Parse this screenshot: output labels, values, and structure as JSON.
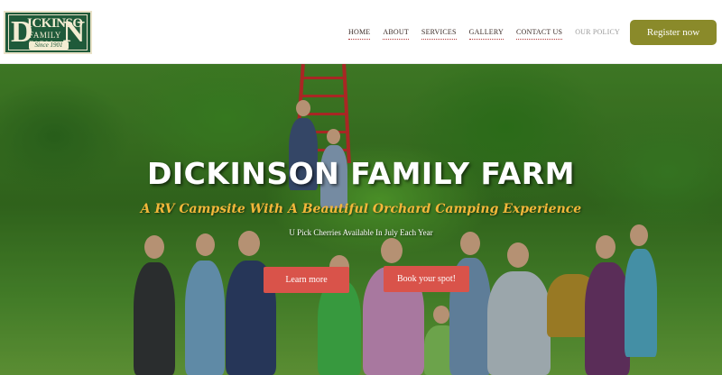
{
  "logo": {
    "line_big_left": "D",
    "line_big_right": "N",
    "line_main": "ICKINSO",
    "line_sub": "FAMILY FARM",
    "line_since": "Since 1901"
  },
  "nav": {
    "items": [
      {
        "label": "HOME"
      },
      {
        "label": "ABOUT"
      },
      {
        "label": "SERVICES"
      },
      {
        "label": "GALLERY"
      },
      {
        "label": "CONTACT US"
      },
      {
        "label": "OUR POLICY"
      }
    ]
  },
  "header": {
    "register_label": "Register now"
  },
  "hero": {
    "title": "DICKINSON FAMILY FARM",
    "subtitle": "A RV Campsite With A Beautiful Orchard Camping Experience",
    "note": "U Pick Cherries Available In July Each Year",
    "learn_more_label": "Learn more",
    "book_label": "Book your spot!"
  },
  "colors": {
    "accent_olive": "#8a8a2a",
    "button_red": "#d9534a",
    "subtitle_gold": "#f3b73a",
    "logo_green": "#1f5a3a"
  }
}
